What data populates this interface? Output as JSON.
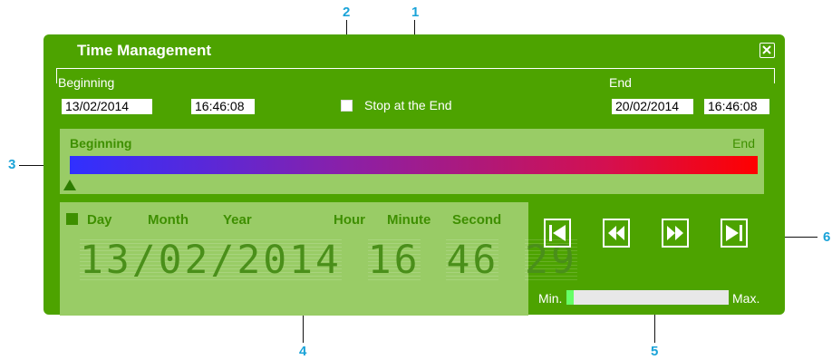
{
  "window": {
    "title": "Time Management",
    "close_icon": "close-icon"
  },
  "range": {
    "beginning_label": "Beginning",
    "begin_date": "13/02/2014",
    "begin_time": "16:46:08",
    "stop_label": "Stop at the End",
    "stop_checked": false,
    "end_label": "End",
    "end_date": "20/02/2014",
    "end_time": "16:46:08"
  },
  "timeline": {
    "beginning_label": "Beginning",
    "end_label": "End",
    "cursor_position": 0
  },
  "date_display": {
    "labels": {
      "day": "Day",
      "month": "Month",
      "year": "Year",
      "hour": "Hour",
      "minute": "Minute",
      "second": "Second"
    },
    "date_text": "13/02/2014",
    "hour": "16",
    "minute": "46",
    "second": "29"
  },
  "playback": {
    "buttons": [
      "go-to-start-icon",
      "rewind-icon",
      "fast-forward-icon",
      "go-to-end-icon"
    ],
    "speed_min_label": "Min.",
    "speed_max_label": "Max.",
    "speed_level": 0.02
  },
  "callouts": {
    "c1": "1",
    "c2": "2",
    "c3": "3",
    "c4": "4",
    "c5": "5",
    "c6": "6"
  },
  "colors": {
    "panel": "#4da300",
    "light_panel": "#99cc66",
    "callout": "#1aa3d8",
    "timeline_start": "#3030ff",
    "timeline_end": "#ff0000"
  }
}
